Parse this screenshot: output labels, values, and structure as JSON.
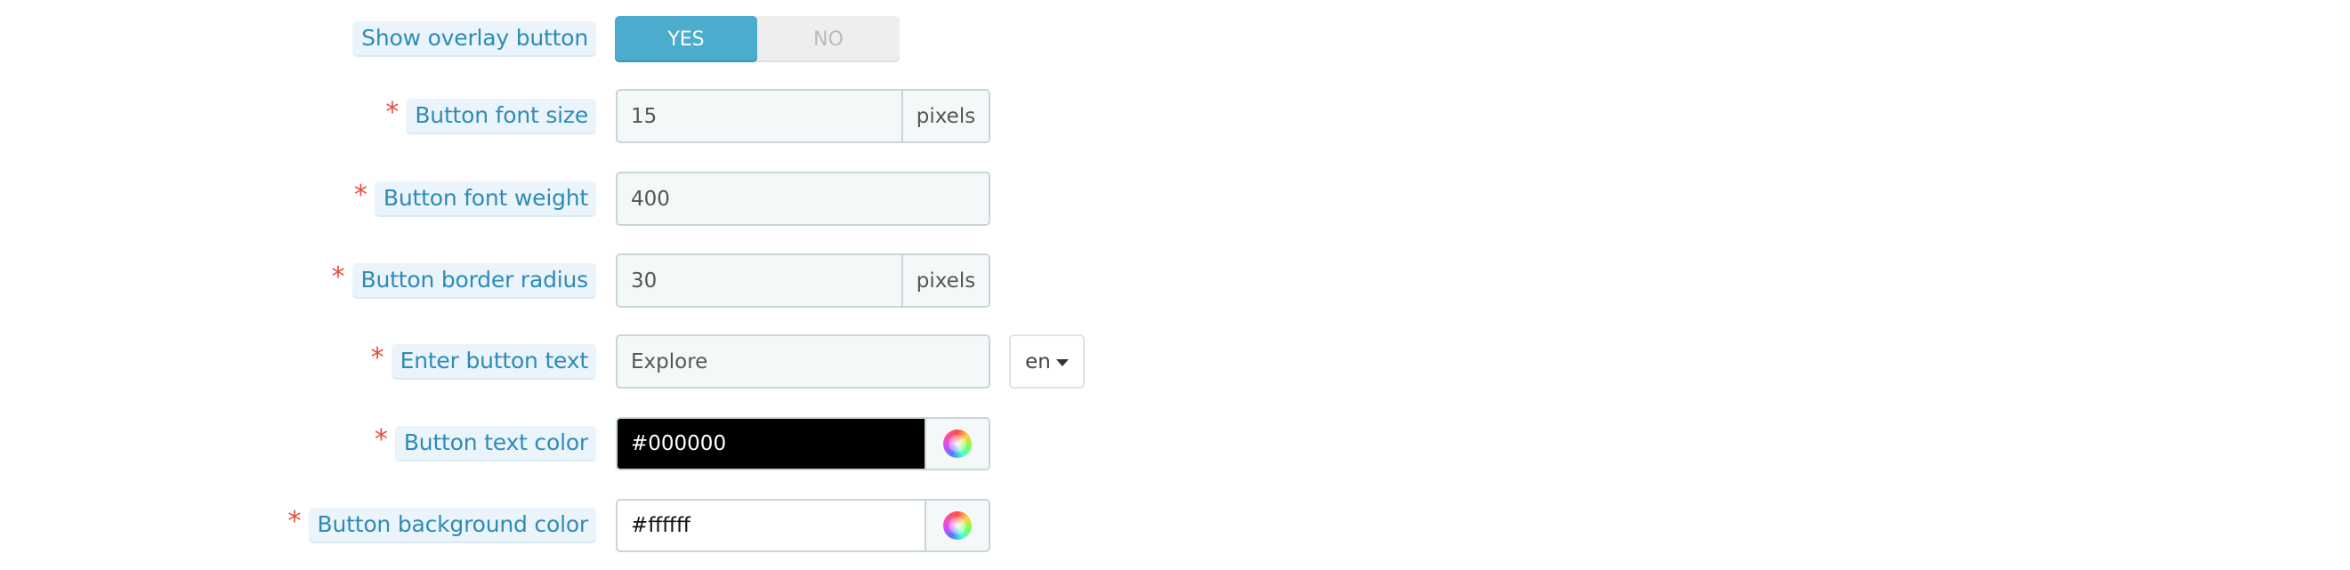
{
  "form": {
    "show_overlay": {
      "label": "Show overlay button",
      "required": false,
      "yes_label": "YES",
      "no_label": "NO",
      "value": "YES"
    },
    "font_size": {
      "label": "Button font size",
      "required": true,
      "required_mark": "*",
      "value": "15",
      "unit": "pixels"
    },
    "font_weight": {
      "label": "Button font weight",
      "required": true,
      "required_mark": "*",
      "value": "400"
    },
    "border_radius": {
      "label": "Button border radius",
      "required": true,
      "required_mark": "*",
      "value": "30",
      "unit": "pixels"
    },
    "button_text": {
      "label": "Enter button text",
      "required": true,
      "required_mark": "*",
      "value": "Explore",
      "language": "en"
    },
    "text_color": {
      "label": "Button text color",
      "required": true,
      "required_mark": "*",
      "value": "#000000",
      "icon": "color-picker-icon"
    },
    "background_color": {
      "label": "Button background color",
      "required": true,
      "required_mark": "*",
      "value": "#ffffff",
      "icon": "color-picker-icon"
    }
  },
  "colors": {
    "accent": "#4bacce",
    "label_text": "#2e8bb8",
    "label_bg": "#eaf4fa",
    "required": "#e74c3c",
    "input_border": "#c7d6db"
  }
}
